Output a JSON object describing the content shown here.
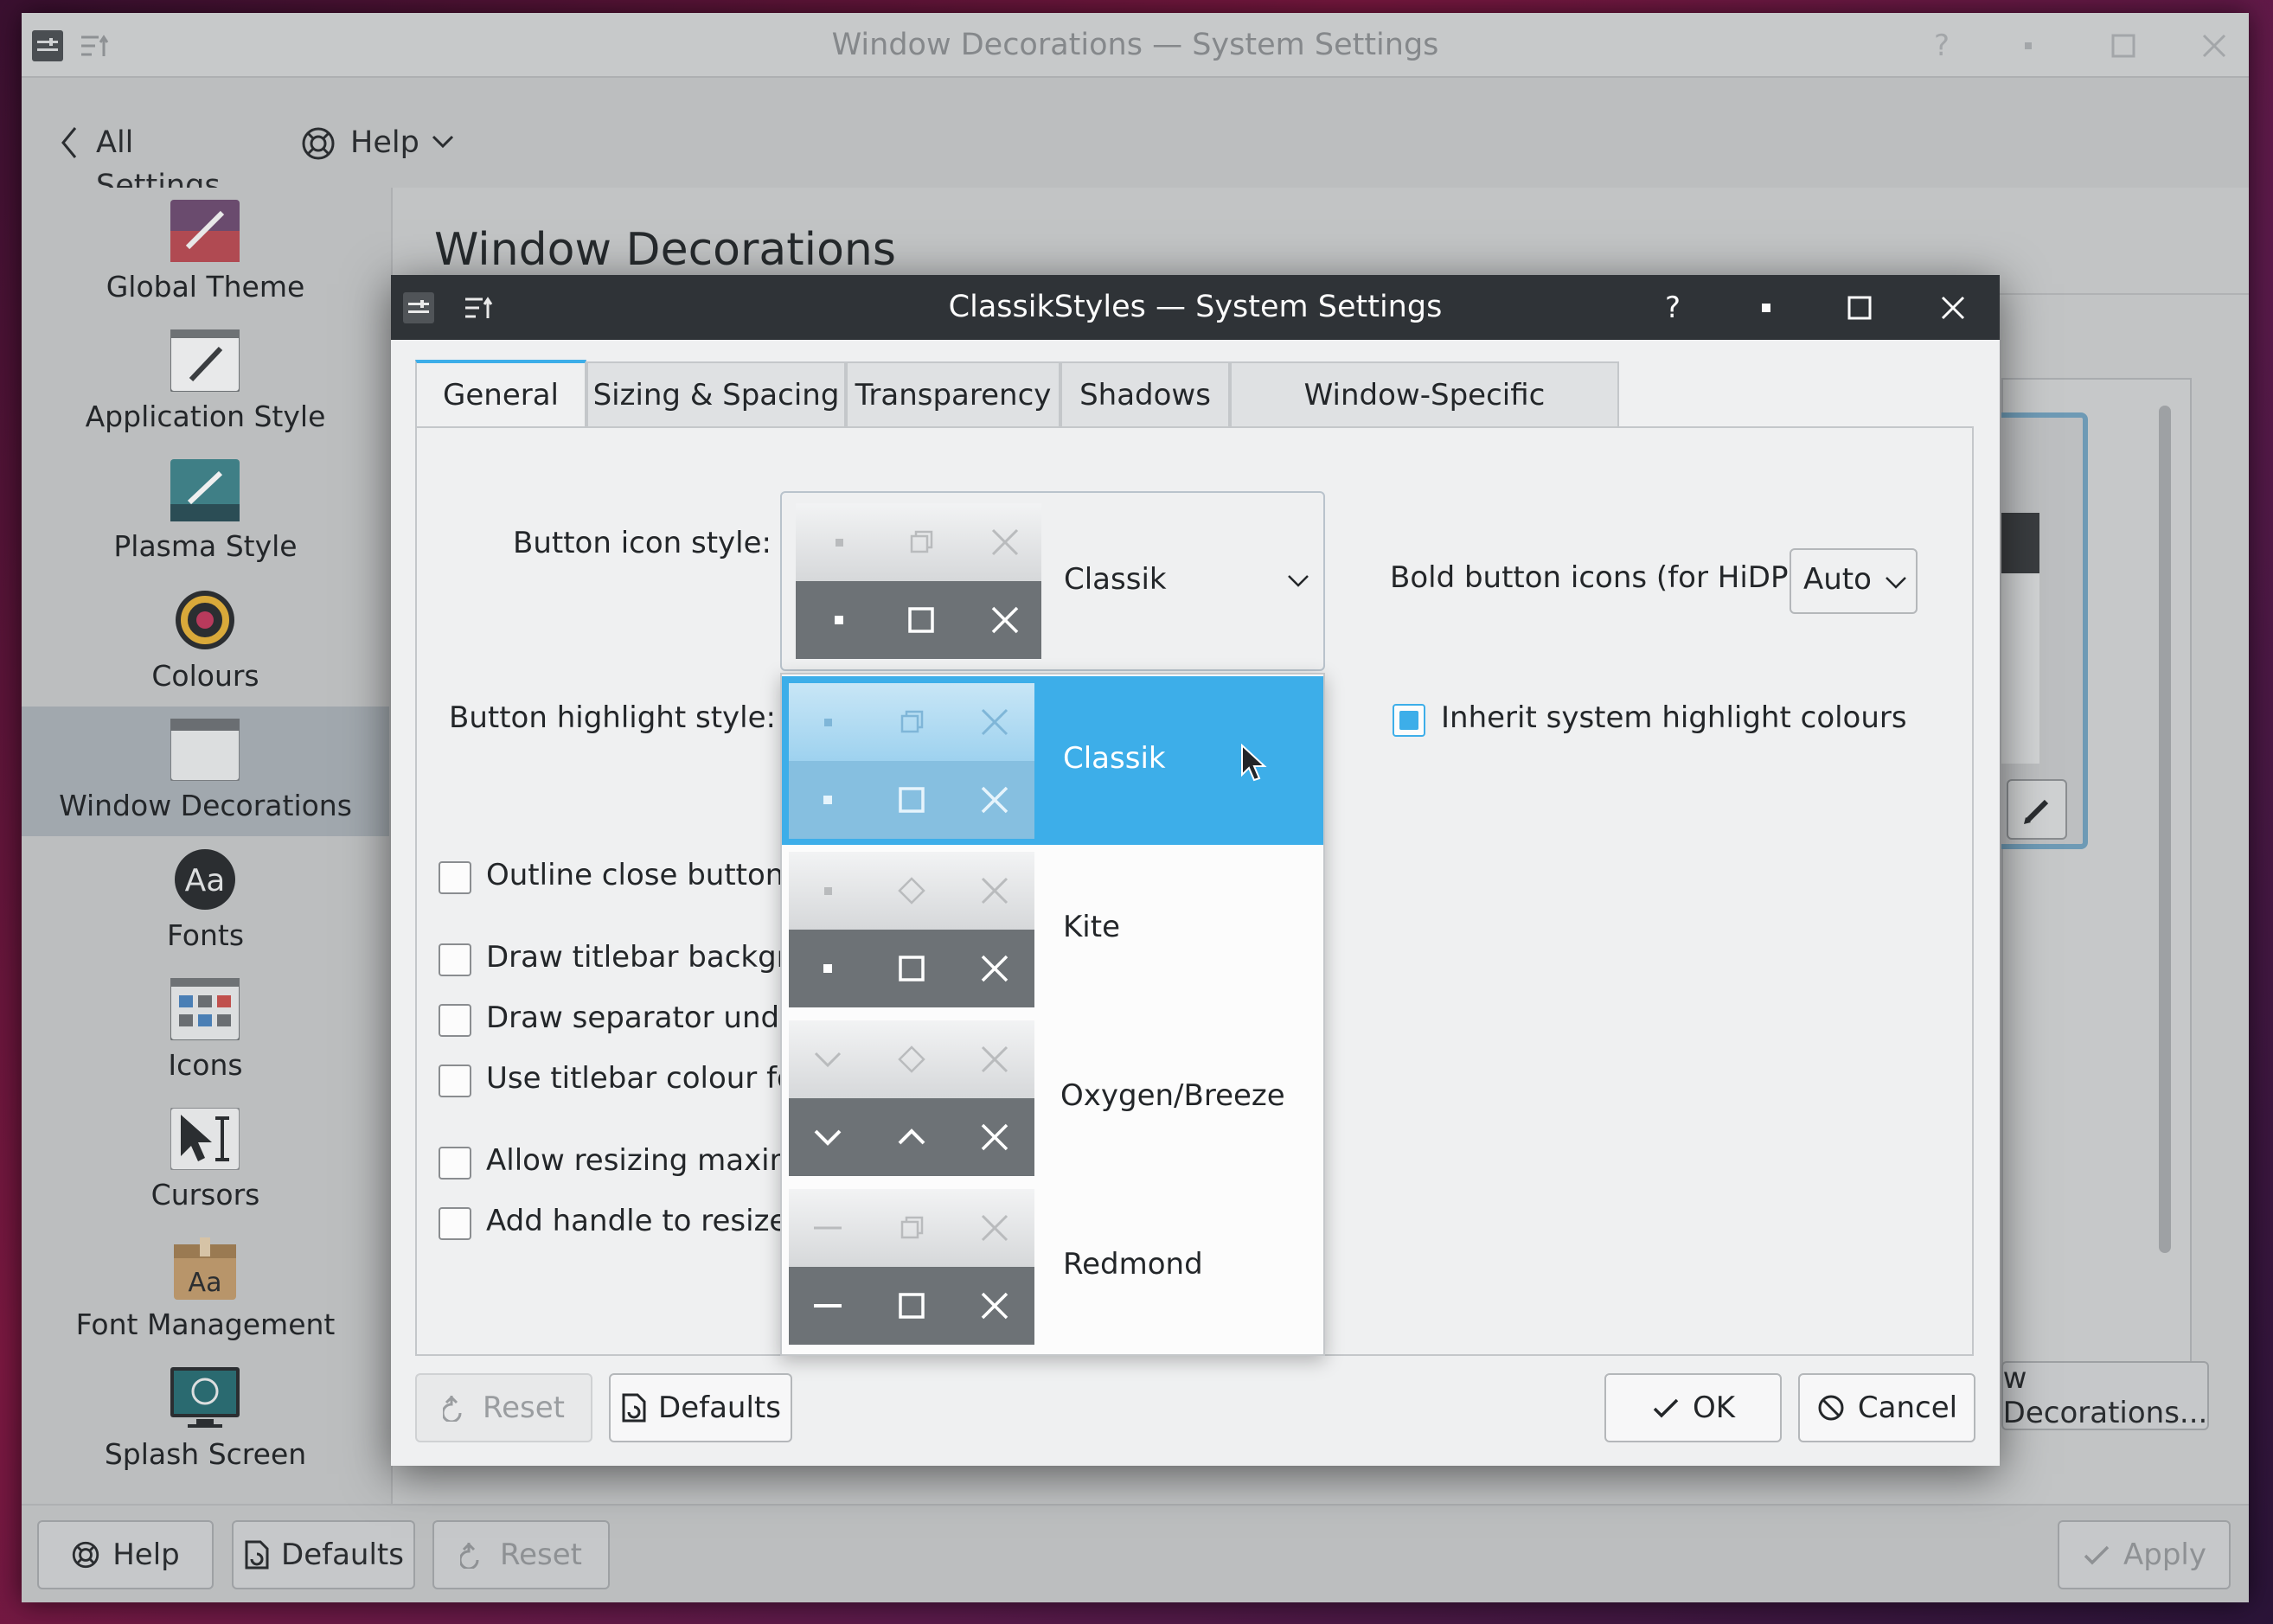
{
  "main_window": {
    "title": "Window Decorations — System Settings",
    "toolbar": {
      "back_label": "All Settings",
      "help_label": "Help"
    },
    "sidebar": [
      {
        "label": "Global Theme"
      },
      {
        "label": "Application Style"
      },
      {
        "label": "Plasma Style"
      },
      {
        "label": "Colours"
      },
      {
        "label": "Window Decorations",
        "selected": true
      },
      {
        "label": "Fonts"
      },
      {
        "label": "Icons"
      },
      {
        "label": "Cursors"
      },
      {
        "label": "Font Management"
      },
      {
        "label": "Splash Screen"
      }
    ],
    "page_title": "Window Decorations",
    "get_new_label": "w Decorations...",
    "bottom": {
      "help": "Help",
      "defaults": "Defaults",
      "reset": "Reset",
      "apply": "Apply"
    }
  },
  "dialog": {
    "title": "ClassikStyles — System Settings",
    "tabs": [
      "General",
      "Sizing & Spacing",
      "Transparency",
      "Shadows",
      "Window-Specific Overrides"
    ],
    "active_tab": "General",
    "button_icon_style_label": "Button icon style:",
    "button_icon_style_value": "Classik",
    "button_highlight_style_label": "Button highlight style:",
    "bold_icons_label": "Bold button icons (for HiDPI):",
    "bold_icons_value": "Auto",
    "inherit_highlight_label": "Inherit system highlight colours",
    "inherit_highlight_checked": true,
    "checkboxes": [
      {
        "label": "Outline close button",
        "checked": false
      },
      {
        "label": "Draw titlebar backgrou",
        "checked": false
      },
      {
        "label": "Draw separator under",
        "checked": false
      },
      {
        "label": "Use titlebar colour for",
        "checked": false
      },
      {
        "label": "Allow resizing maximiz",
        "checked": false
      },
      {
        "label": "Add handle to resize w",
        "checked": false
      }
    ],
    "dropdown_options": [
      {
        "label": "Classik",
        "selected": true,
        "icons": [
          "dot",
          "restore",
          "close"
        ]
      },
      {
        "label": "Kite",
        "selected": false,
        "icons": [
          "dot",
          "diamond",
          "close"
        ]
      },
      {
        "label": "Oxygen/Breeze",
        "selected": false,
        "icons": [
          "chevron-down",
          "chevron-up",
          "close"
        ]
      },
      {
        "label": "Redmond",
        "selected": false,
        "icons": [
          "dash",
          "restore",
          "close"
        ]
      }
    ],
    "buttons": {
      "reset": "Reset",
      "defaults": "Defaults",
      "ok": "OK",
      "cancel": "Cancel"
    }
  },
  "colors": {
    "accent": "#3daee9",
    "dialog_titlebar": "#2f3337"
  }
}
